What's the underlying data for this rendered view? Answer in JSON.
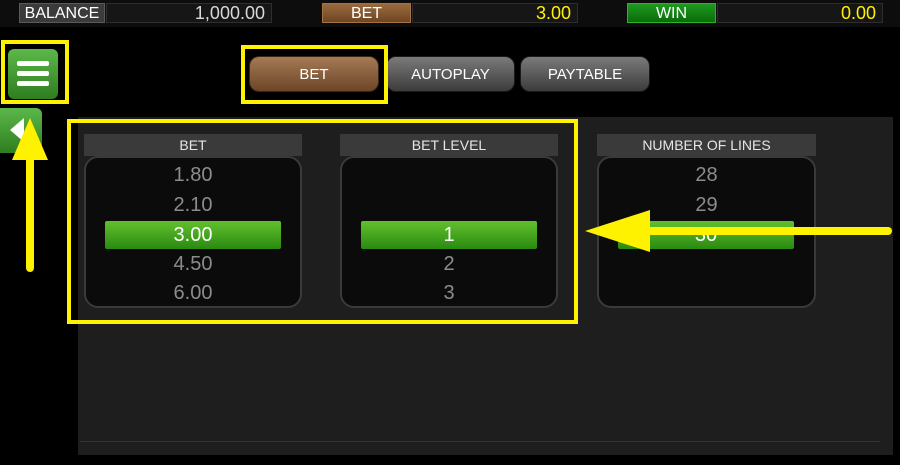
{
  "topbar": {
    "balance_label": "BALANCE",
    "balance_value": "1,000.00",
    "bet_label": "BET",
    "bet_value": "3.00",
    "win_label": "WIN",
    "win_value": "0.00"
  },
  "tabs": [
    {
      "label": "BET",
      "active": true
    },
    {
      "label": "AUTOPLAY",
      "active": false
    },
    {
      "label": "PAYTABLE",
      "active": false
    }
  ],
  "menu": {
    "icon": "hamburger-menu-icon",
    "back_icon": "arrow-left-icon"
  },
  "columns": [
    {
      "title": "BET",
      "items": [
        "1.80",
        "2.10",
        "3.00",
        "4.50",
        "6.00"
      ],
      "selected": "3.00"
    },
    {
      "title": "BET LEVEL",
      "items": [
        "1",
        "2",
        "3"
      ],
      "selected": "1"
    },
    {
      "title": "NUMBER OF LINES",
      "items": [
        "28",
        "29",
        "30"
      ],
      "selected": "30"
    }
  ],
  "colors": {
    "annotation": "#fff200",
    "accent_green": "#3fa51f",
    "bet_brown": "#8b5a33",
    "value_yellow": "#fff200"
  }
}
